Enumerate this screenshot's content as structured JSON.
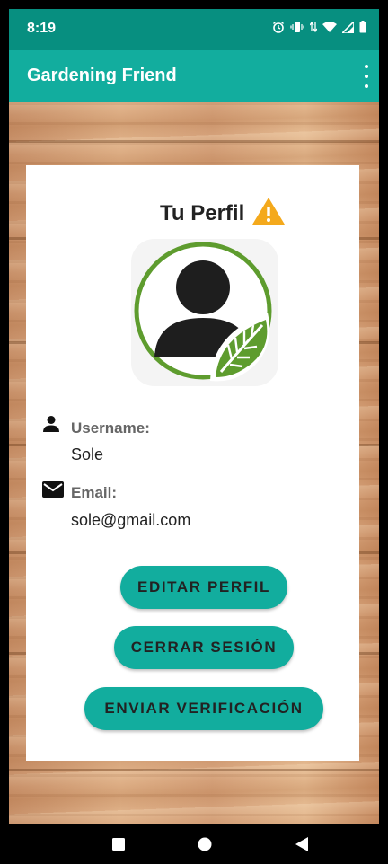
{
  "status": {
    "time": "8:19"
  },
  "appbar": {
    "title": "Gardening Friend"
  },
  "profile": {
    "title": "Tu Perfil",
    "username_label": "Username:",
    "username_value": "Sole",
    "email_label": "Email:",
    "email_value": "sole@gmail.com"
  },
  "buttons": {
    "edit": "EDITAR PERFIL",
    "logout": "CERRAR SESIÓN",
    "verify": "ENVIAR VERIFICACIÓN"
  },
  "icons": {
    "warning": "warning-icon",
    "username": "person-icon",
    "email": "mail-icon",
    "menu": "more-vert-icon"
  },
  "colors": {
    "status_bar": "#078f80",
    "app_bar": "#12ad9e",
    "button": "#12ad9e",
    "warning": "#f4a91c",
    "avatar_green": "#5e9c2e"
  }
}
